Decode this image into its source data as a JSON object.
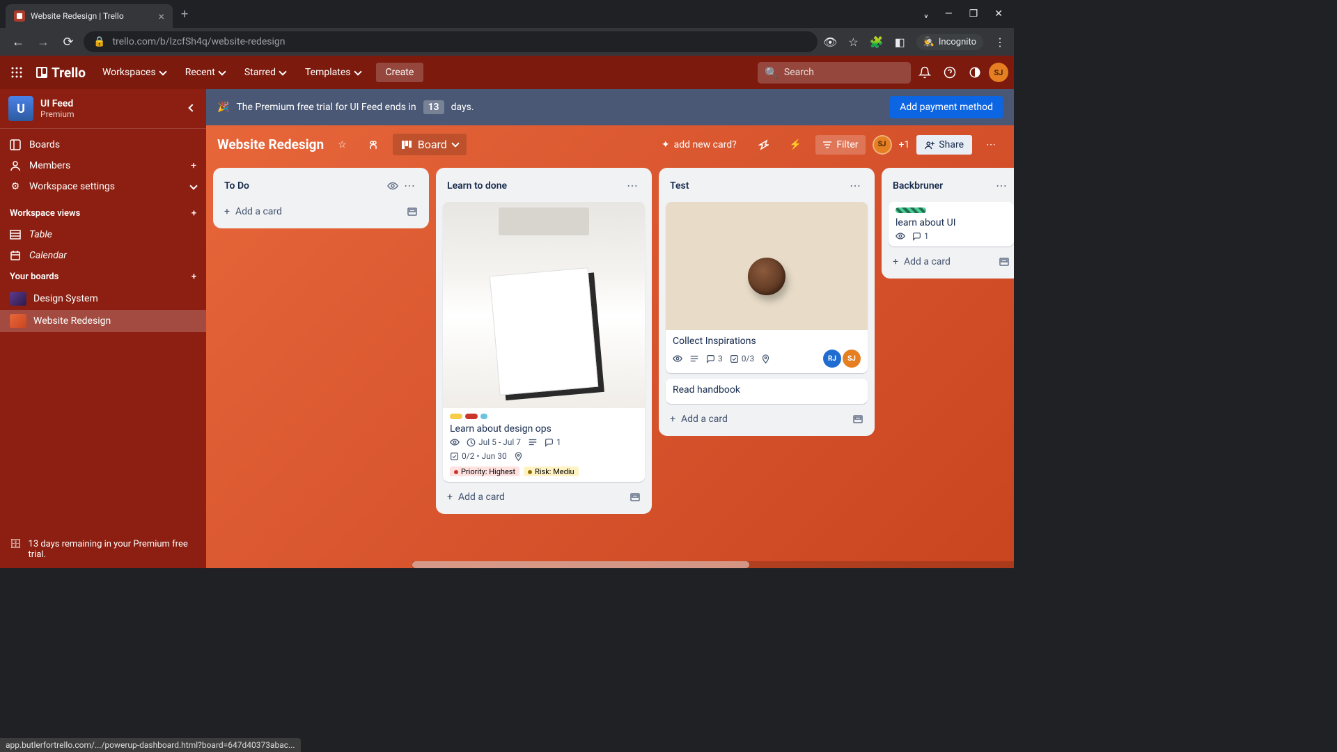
{
  "browser": {
    "tab_title": "Website Redesign | Trello",
    "url": "trello.com/b/lzcfSh4q/website-redesign",
    "incognito_label": "Incognito",
    "status_bar": "app.butlerfortrello.com/.../powerup-dashboard.html?board=647d40373abac..."
  },
  "header": {
    "logo_text": "Trello",
    "menu": [
      "Workspaces",
      "Recent",
      "Starred",
      "Templates"
    ],
    "create": "Create",
    "search_placeholder": "Search",
    "avatar_initials": "SJ"
  },
  "sidebar": {
    "workspace_initial": "U",
    "workspace_name": "UI Feed",
    "workspace_tier": "Premium",
    "nav": {
      "boards": "Boards",
      "members": "Members",
      "settings": "Workspace settings"
    },
    "views_heading": "Workspace views",
    "views": [
      "Table",
      "Calendar"
    ],
    "boards_heading": "Your boards",
    "boards": [
      {
        "name": "Design System",
        "color": "linear-gradient(135deg,#5e3a8c,#2d1b4a)"
      },
      {
        "name": "Website Redesign",
        "color": "linear-gradient(135deg,#e8673a,#c94520)"
      }
    ],
    "trial_text": "13 days remaining in your Premium free trial."
  },
  "banner": {
    "prefix": "The Premium free trial for UI Feed ends in",
    "days": "13",
    "suffix": "days.",
    "cta": "Add payment method"
  },
  "board": {
    "title": "Website Redesign",
    "view_label": "Board",
    "butler_hint": "add new card?",
    "filter": "Filter",
    "share": "Share",
    "extra_members": "+1",
    "member_initials": "SJ"
  },
  "lists": [
    {
      "title": "To Do",
      "show_watch": true,
      "cards": [],
      "add_label": "Add a card"
    },
    {
      "title": "Learn to done",
      "cards": [
        {
          "cover": "notebook",
          "labels": [
            {
              "w": 18,
              "c": "#f5cd47"
            },
            {
              "w": 18,
              "c": "#c9372c"
            },
            {
              "w": 10,
              "c": "#6cc3e0"
            }
          ],
          "title": "Learn about design ops",
          "watch": true,
          "dates": "Jul 5 - Jul 7",
          "desc": true,
          "comments": "1",
          "checklist": "0/2 • Jun 30",
          "location": true,
          "custom_fields": [
            {
              "text": "Priority: Highest",
              "bg": "#ffe2e0",
              "dot": "#c9372c"
            },
            {
              "text": "Risk: Mediu",
              "bg": "#fff3c4",
              "dot": "#946f00"
            }
          ]
        }
      ],
      "add_label": "Add a card"
    },
    {
      "title": "Test",
      "cards": [
        {
          "cover": "coffee",
          "title": "Collect Inspirations",
          "watch": true,
          "desc": true,
          "comments": "3",
          "checklist": "0/3",
          "location": true,
          "members": [
            {
              "initials": "RJ",
              "bg": "#1f6dd0"
            },
            {
              "initials": "SJ",
              "bg": "#e67e22"
            }
          ]
        },
        {
          "title": "Read handbook"
        }
      ],
      "add_label": "Add a card"
    },
    {
      "title": "Backbruner",
      "narrow": true,
      "cards": [
        {
          "labels": [
            {
              "w": 44,
              "c": "repeating-linear-gradient(45deg,#4bce97,#4bce97 4px,#216e4e 4px,#216e4e 8px)"
            }
          ],
          "title": "learn about UI",
          "watch": true,
          "comments": "1"
        }
      ],
      "add_label": "Add a card"
    }
  ]
}
